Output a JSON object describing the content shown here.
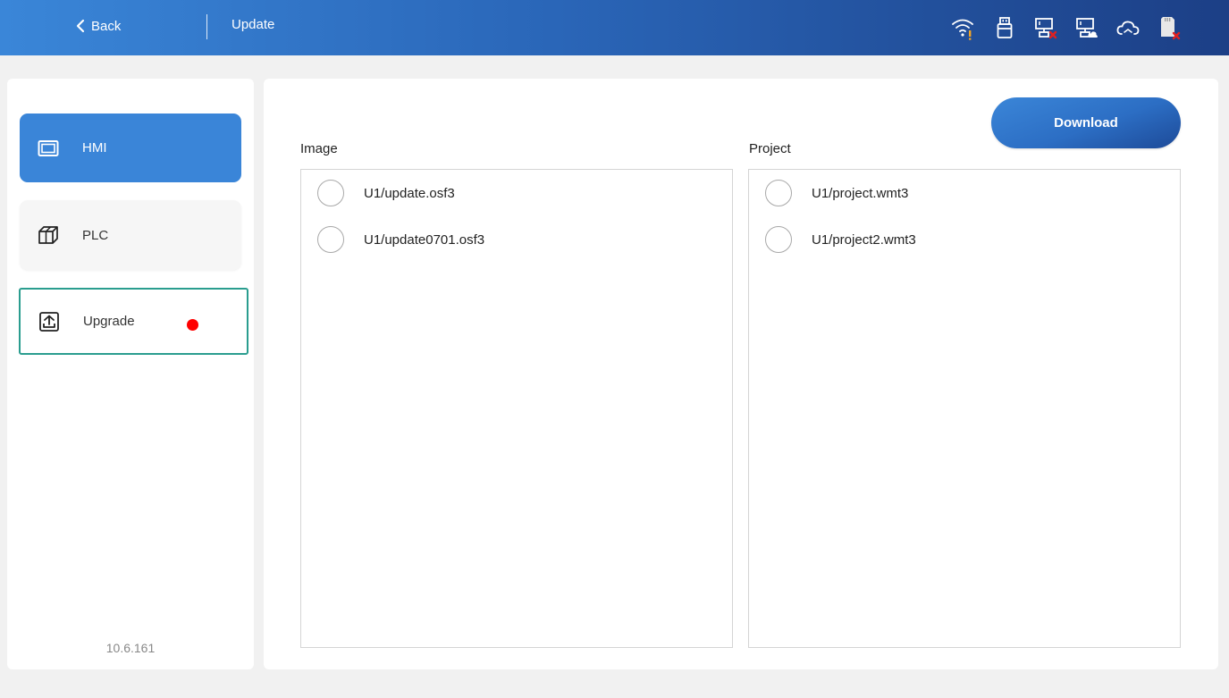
{
  "header": {
    "back_label": "Back",
    "title": "Update",
    "status_icons": [
      "wifi-warning-icon",
      "usb-drive-icon",
      "network-disconnected-icon",
      "network-cloud-icon",
      "cloud-icon",
      "sd-card-error-icon"
    ]
  },
  "sidebar": {
    "items": [
      {
        "label": "HMI",
        "icon": "monitor-icon",
        "state": "selected"
      },
      {
        "label": "PLC",
        "icon": "cube-icon"
      },
      {
        "label": "Upgrade",
        "icon": "upload-icon",
        "badge": "red-dot"
      }
    ],
    "version": "10.6.161"
  },
  "main": {
    "download_label": "Download",
    "image": {
      "label": "Image",
      "files": [
        "U1/update.osf3",
        "U1/update0701.osf3"
      ]
    },
    "project": {
      "label": "Project",
      "files": [
        "U1/project.wmt3",
        "U1/project2.wmt3"
      ]
    }
  },
  "colors": {
    "accent": "#3a85d8",
    "header_dark": "#1c3f86",
    "focus_border": "#2a9d8f",
    "badge_red": "#ff0000",
    "warning_orange": "#f5a623",
    "error_red": "#e02020"
  }
}
